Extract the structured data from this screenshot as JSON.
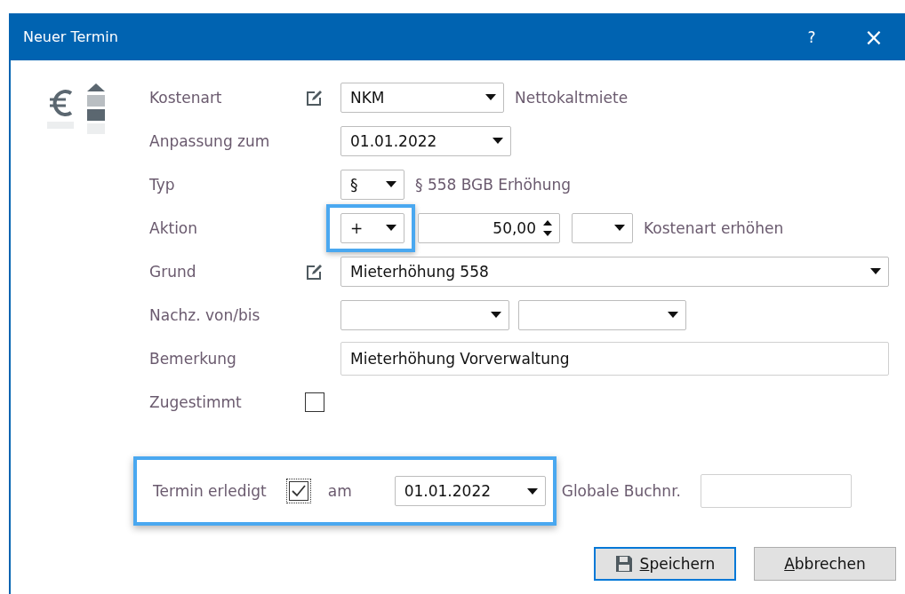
{
  "window": {
    "title": "Neuer Termin",
    "help": "?",
    "close": "×"
  },
  "kostenart": {
    "label": "Kostenart",
    "value": "NKM",
    "description": "Nettokaltmiete"
  },
  "anpassung": {
    "label": "Anpassung zum",
    "value": "01.01.2022"
  },
  "typ": {
    "label": "Typ",
    "value": "§",
    "description": "§ 558 BGB Erhöhung"
  },
  "aktion": {
    "label": "Aktion",
    "operator": "+",
    "operator_highlighted": true,
    "amount": "50,00",
    "description": "Kostenart erhöhen"
  },
  "grund": {
    "label": "Grund",
    "value": "Mieterhöhung 558"
  },
  "nachzahlung": {
    "label": "Nachz. von/bis"
  },
  "bemerkung": {
    "label": "Bemerkung",
    "value": "Mieterhöhung Vorverwaltung"
  },
  "zugestimmt": {
    "label": "Zugestimmt",
    "checked": false
  },
  "erledigt": {
    "label": "Termin erledigt",
    "checked": true,
    "am": "am",
    "date": "01.01.2022",
    "highlighted": true
  },
  "buchnr": {
    "label": "Globale Buchnr."
  },
  "buttons": [
    {
      "label": "Speichern",
      "kind": "save",
      "default": true
    },
    {
      "label": "Abbrechen",
      "kind": "cancel",
      "default": false
    }
  ]
}
